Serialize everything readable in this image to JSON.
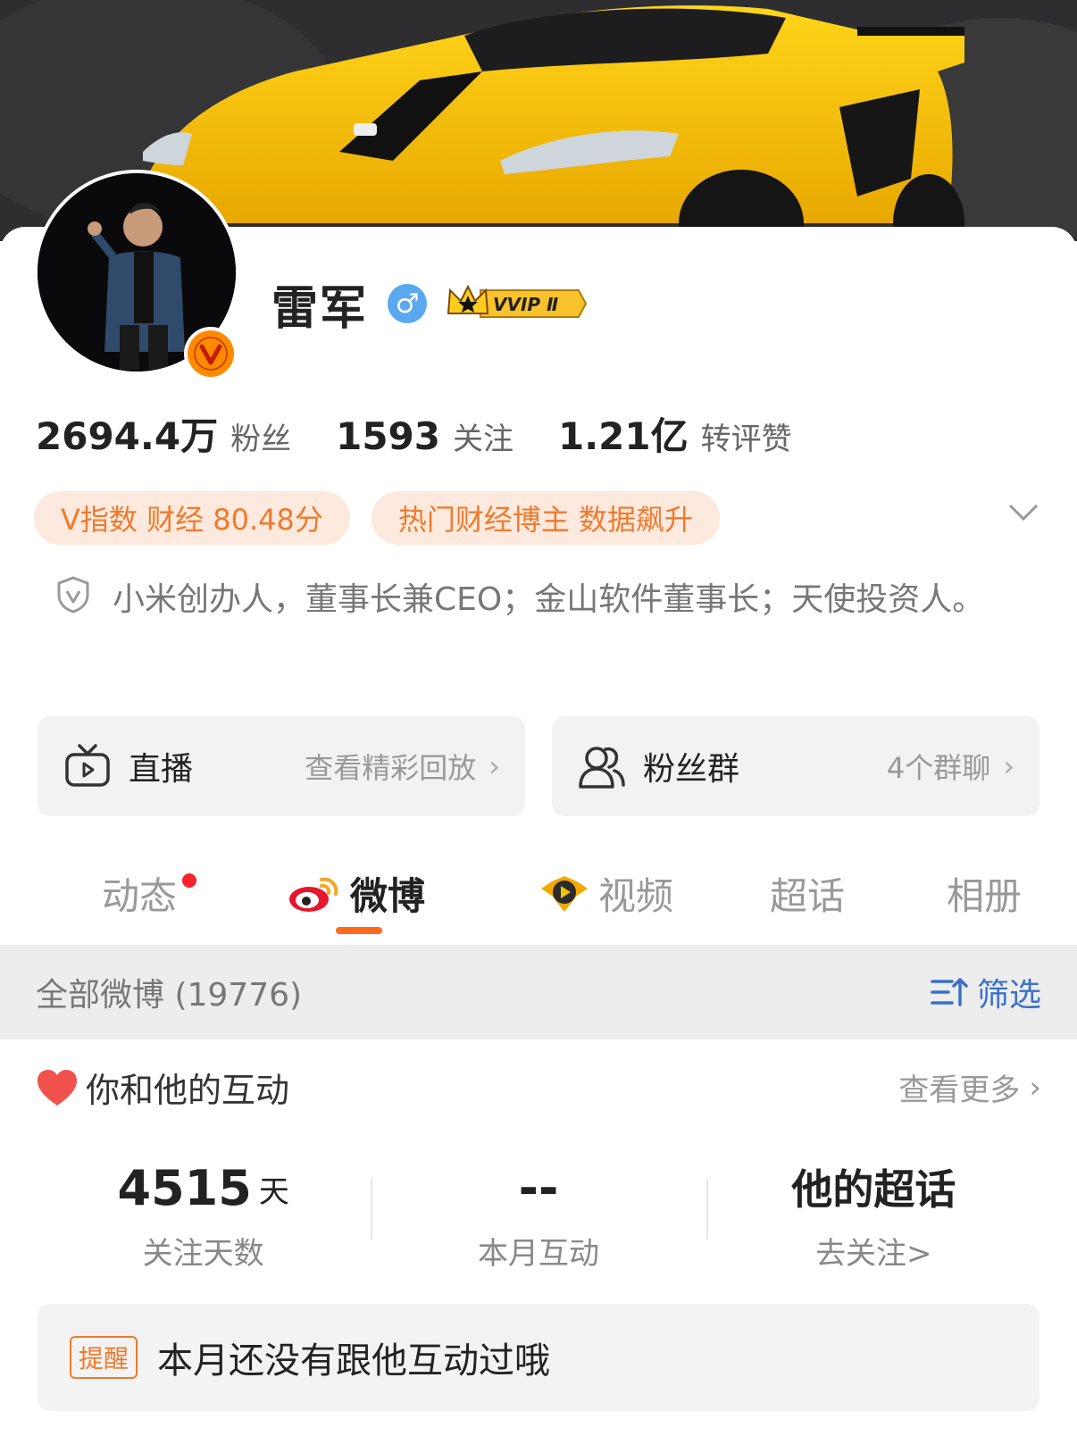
{
  "profile": {
    "name": "雷军",
    "gender_symbol": "♂",
    "vip_badge": "VVIP Ⅱ",
    "verified_badge": "V"
  },
  "stats": [
    {
      "value": "2694.4",
      "unit": "万",
      "label": "粉丝"
    },
    {
      "value": "1593",
      "unit": "",
      "label": "关注"
    },
    {
      "value": "1.21",
      "unit": "亿",
      "label": "转评赞"
    }
  ],
  "tags": [
    "V指数 财经 80.48分",
    "热门财经博主 数据飙升"
  ],
  "bio": "小米创办人，董事长兼CEO；金山软件董事长；天使投资人。",
  "tiles": {
    "live": {
      "title": "直播",
      "sub": "查看精彩回放",
      "chevron": "›"
    },
    "fans": {
      "title": "粉丝群",
      "sub": "4个群聊",
      "chevron": "›"
    }
  },
  "tabs": [
    "动态",
    "微博",
    "视频",
    "超话",
    "相册"
  ],
  "active_tab": "微博",
  "filter_bar": {
    "all_posts": "全部微博 (19776)",
    "filter_label": "筛选"
  },
  "interaction": {
    "title": "你和他的互动",
    "more": "查看更多",
    "more_chevron": "›",
    "metrics": [
      {
        "big": "4515",
        "unit": "天",
        "label": "关注天数"
      },
      {
        "big": "--",
        "unit": "",
        "label": "本月互动"
      },
      {
        "big": "他的超话",
        "unit": "",
        "label": "去关注>"
      }
    ]
  },
  "reminder": {
    "tag": "提醒",
    "text": "本月还没有跟他互动过哦"
  },
  "colors": {
    "accent_orange": "#ff6a1a",
    "tag_bg": "#fde9dd",
    "tag_text": "#f07a2c",
    "link_blue": "#3a70c9",
    "notification_red": "#f6242b"
  },
  "icons": [
    "tv-icon",
    "group-icon",
    "weibo-logo-icon",
    "video-icon",
    "shield-icon",
    "chevron-down-icon",
    "filter-icon",
    "heart-icon",
    "gender-male-icon",
    "crown-icon",
    "verified-v-icon"
  ]
}
